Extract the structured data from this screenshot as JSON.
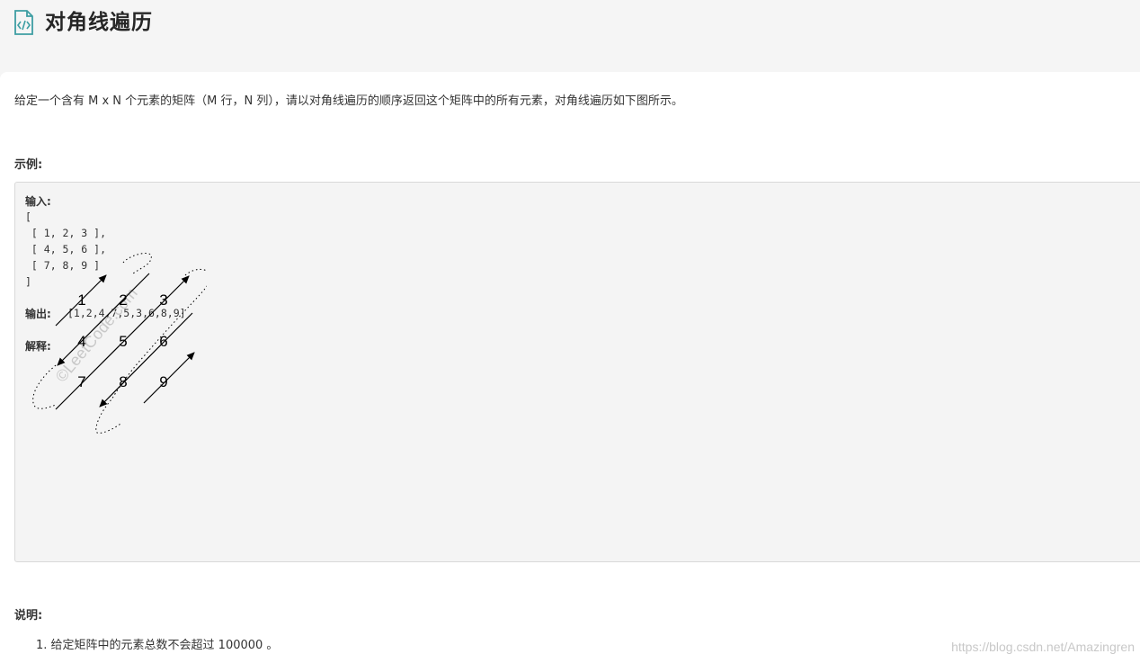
{
  "header": {
    "title": "对角线遍历",
    "icon": "code-file-icon"
  },
  "problem": {
    "description": "给定一个含有 M x N 个元素的矩阵（M 行，N 列），请以对角线遍历的顺序返回这个矩阵中的所有元素，对角线遍历如下图所示。",
    "example_label": "示例:",
    "input_label": "输入:",
    "input_lines": [
      "[",
      " [ 1, 2, 3 ],",
      " [ 4, 5, 6 ],",
      " [ 7, 8, 9 ]",
      "]"
    ],
    "output_label": "输出:",
    "output_value": "[1,2,4,7,5,3,6,8,9]",
    "explain_label": "解释:",
    "diagram_numbers": [
      "1",
      "2",
      "3",
      "4",
      "5",
      "6",
      "7",
      "8",
      "9"
    ],
    "diagram_watermark": "©LeetCode.com",
    "notes_label": "说明:",
    "notes": [
      "1. 给定矩阵中的元素总数不会超过 100000 。"
    ]
  },
  "watermark": "https://blog.csdn.net/Amazingren",
  "colors": {
    "accent": "#3e9ea3",
    "code_bg": "#f4f4f4",
    "text": "#333333"
  }
}
